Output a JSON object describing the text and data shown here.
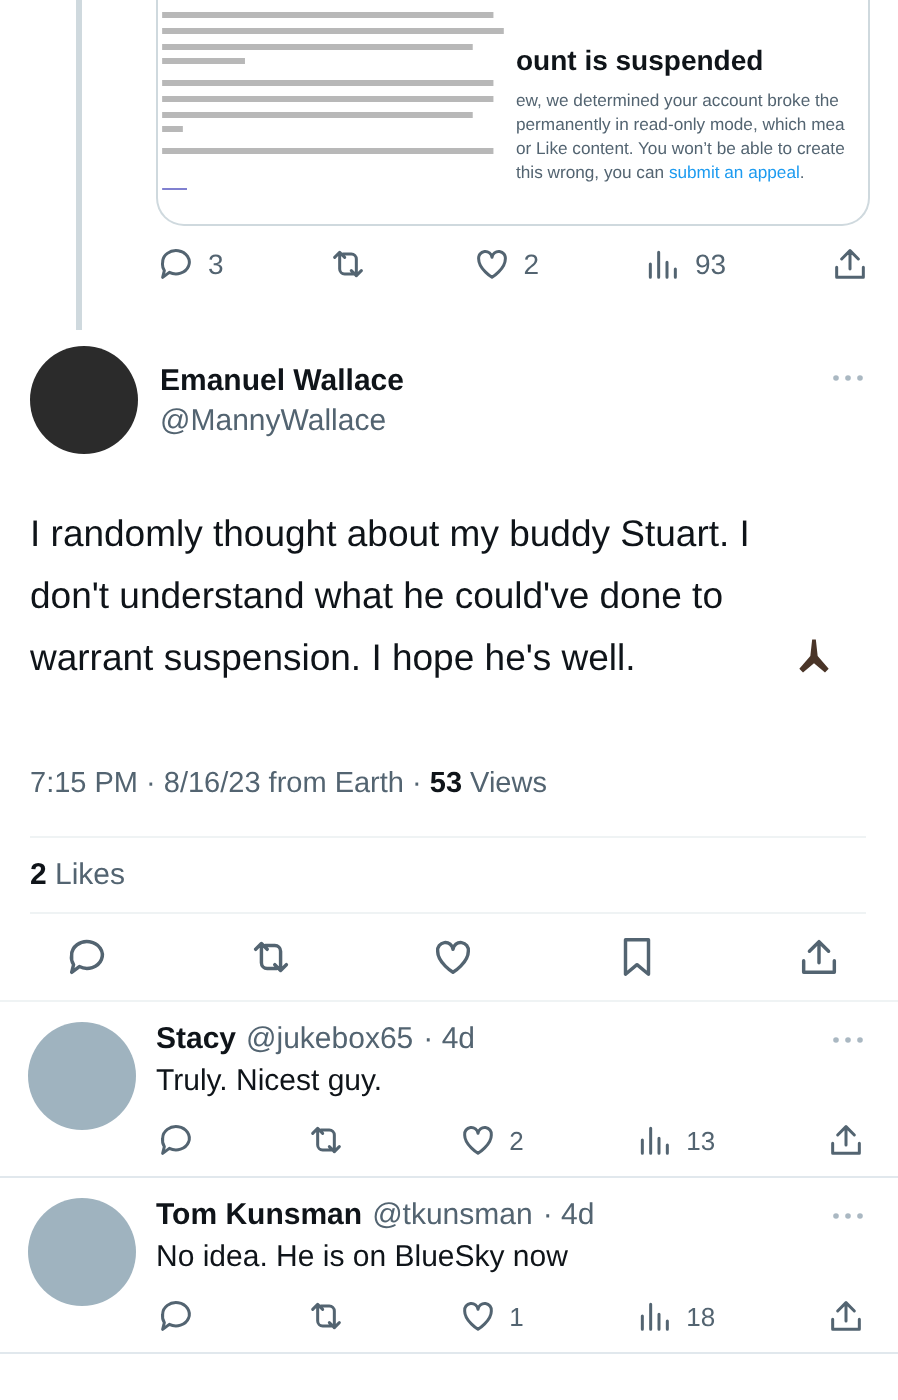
{
  "quoted_card": {
    "heading": "ount is suspended",
    "lines": [
      "ew, we determined your account broke the",
      "permanently in read-only mode, which mea",
      "or Like content. You won’t be able to create"
    ],
    "last_line": "this wrong, you can ",
    "link": "submit an appeal",
    "end": "."
  },
  "quoted_actions": [
    {
      "kind": "reply",
      "count": "3"
    },
    {
      "kind": "repost"
    },
    {
      "kind": "like",
      "count": "2"
    },
    {
      "kind": "views",
      "count": "93"
    },
    {
      "kind": "share"
    }
  ],
  "main_tweet": {
    "name": "Emanuel Wallace",
    "handle": "@MannyWallace",
    "text": "I randomly thought about my buddy Stuart. I don't understand what he could've done to warrant suspension. I hope he's well.",
    "meta": "7:15 PM · 8/16/23 from Earth · ",
    "views_count": "53",
    "views_label": " Views",
    "likes_count": "2",
    "likes_label": " Likes"
  },
  "main_actions": [
    {
      "kind": "reply"
    },
    {
      "kind": "repost"
    },
    {
      "kind": "like"
    },
    {
      "kind": "bookmark"
    },
    {
      "kind": "share"
    }
  ],
  "replies": [
    {
      "name": "Stacy",
      "handle": "@jukebox65",
      "time": "· 4d",
      "text": "Truly. Nicest guy.",
      "actions": [
        {
          "kind": "reply"
        },
        {
          "kind": "repost"
        },
        {
          "kind": "like",
          "count": "2"
        },
        {
          "kind": "views",
          "count": "13"
        },
        {
          "kind": "share"
        }
      ]
    },
    {
      "name": "Tom Kunsman",
      "handle": "@tkunsman",
      "time": "· 4d",
      "text": "No idea. He is on BlueSky now",
      "actions": [
        {
          "kind": "reply"
        },
        {
          "kind": "repost"
        },
        {
          "kind": "like",
          "count": "1"
        },
        {
          "kind": "views",
          "count": "18"
        },
        {
          "kind": "share"
        }
      ]
    }
  ]
}
